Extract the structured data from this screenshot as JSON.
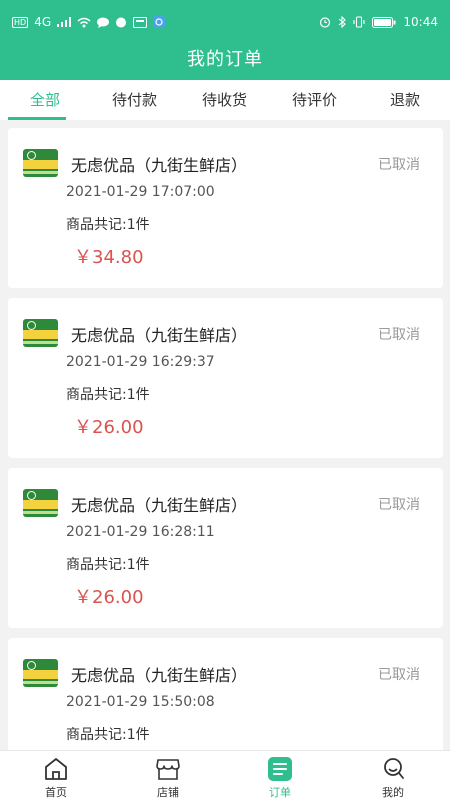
{
  "statusbar": {
    "left_badges": [
      "HD",
      "4G"
    ],
    "time": "10:44"
  },
  "header": {
    "title": "我的订单",
    "accent": "#2fbf8f"
  },
  "tabs": [
    {
      "label": "全部",
      "active": true
    },
    {
      "label": "待付款",
      "active": false
    },
    {
      "label": "待收货",
      "active": false
    },
    {
      "label": "待评价",
      "active": false
    },
    {
      "label": "退款",
      "active": false
    }
  ],
  "orders": [
    {
      "shop": "无虑优品（九街生鲜店）",
      "status": "已取消",
      "time": "2021-01-29 17:07:00",
      "count": "商品共记:1件",
      "price": "￥34.80"
    },
    {
      "shop": "无虑优品（九街生鲜店）",
      "status": "已取消",
      "time": "2021-01-29 16:29:37",
      "count": "商品共记:1件",
      "price": "￥26.00"
    },
    {
      "shop": "无虑优品（九街生鲜店）",
      "status": "已取消",
      "time": "2021-01-29 16:28:11",
      "count": "商品共记:1件",
      "price": "￥26.00"
    },
    {
      "shop": "无虑优品（九街生鲜店）",
      "status": "已取消",
      "time": "2021-01-29 15:50:08",
      "count": "商品共记:1件",
      "price": ""
    }
  ],
  "bottom_nav": [
    {
      "label": "首页",
      "icon": "home-icon",
      "active": false
    },
    {
      "label": "店铺",
      "icon": "store-icon",
      "active": false
    },
    {
      "label": "订单",
      "icon": "order-icon",
      "active": true
    },
    {
      "label": "我的",
      "icon": "profile-icon",
      "active": false
    }
  ],
  "colors": {
    "accent": "#2fbf8f",
    "price": "#d9534f",
    "muted": "#999999"
  }
}
